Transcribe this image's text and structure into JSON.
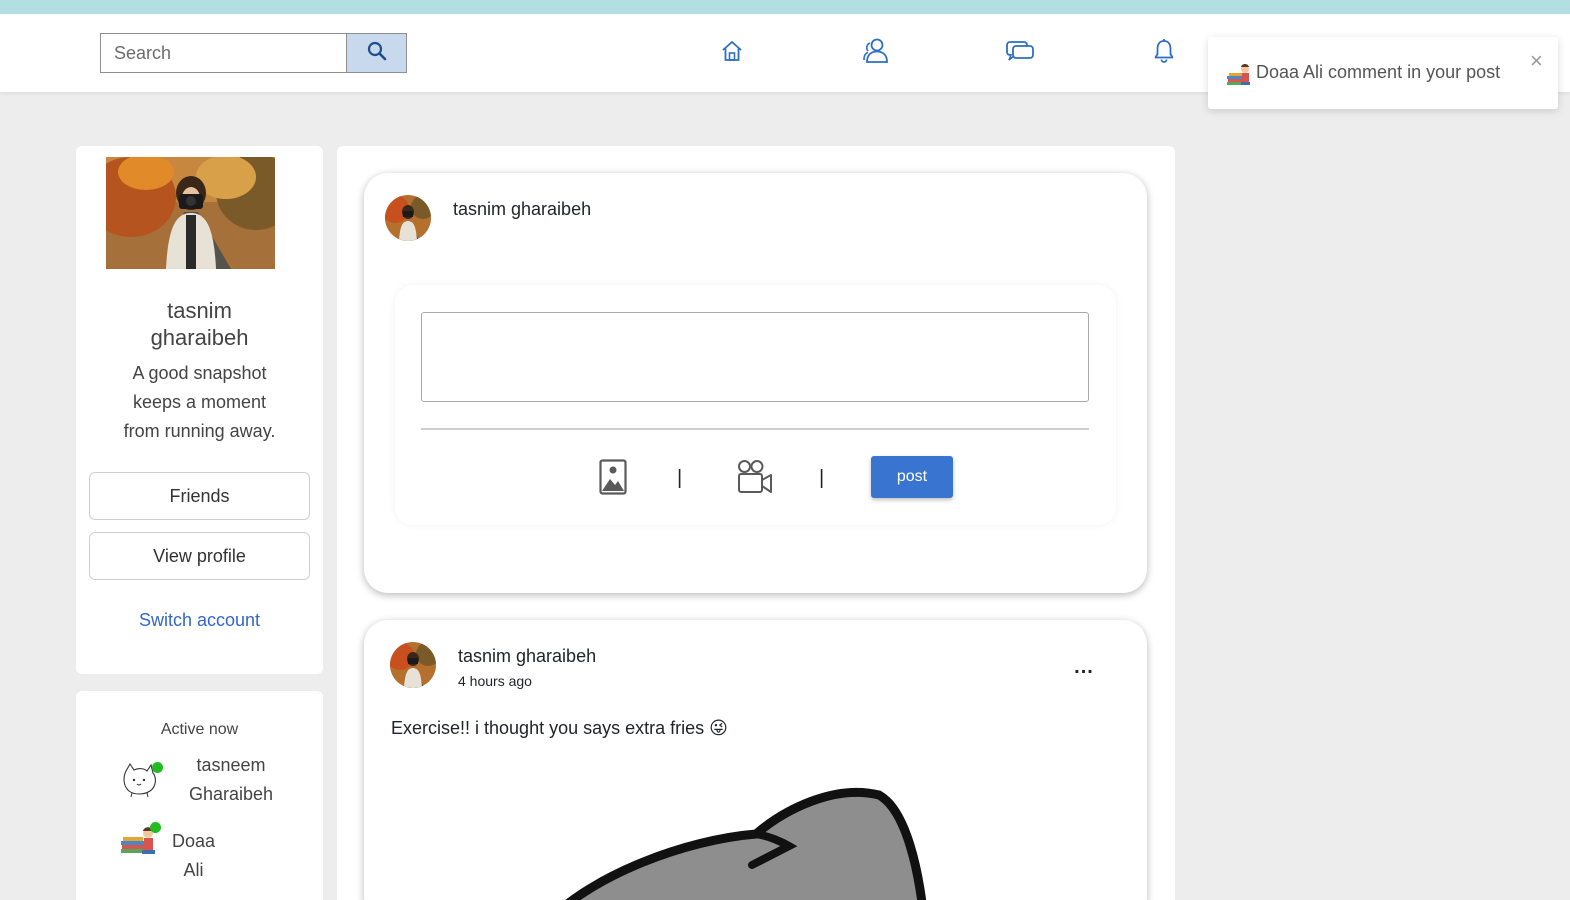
{
  "colors": {
    "top_strip": "#b3dfe2",
    "accent_blue": "#3a74d1",
    "link_blue": "#3366cc",
    "online_green": "#22bb22",
    "page_bg": "#ededed"
  },
  "navbar": {
    "search": {
      "placeholder": "Search",
      "value": "",
      "icon": "search-icon"
    },
    "icons": [
      "home-icon",
      "friends-icon",
      "messages-icon",
      "notifications-icon"
    ]
  },
  "notification_toast": {
    "icon": "books-avatar-icon",
    "text": "Doaa Ali comment in your post",
    "close": "×"
  },
  "profile": {
    "name": "tasnim gharaibeh",
    "bio": "A good snapshot keeps a moment from running away.",
    "friends_button": "Friends",
    "view_profile_button": "View profile",
    "switch_account_link": "Switch account"
  },
  "active_now": {
    "title": "Active now",
    "users": [
      {
        "name": "tasneem Gharaibeh",
        "avatar": "cat-sketch-avatar",
        "online": true
      },
      {
        "name": "Doaa Ali",
        "avatar": "books-avatar",
        "online": true
      }
    ]
  },
  "create_post": {
    "author": "tasnim gharaibeh",
    "text_value": "",
    "image_icon": "image-icon",
    "video_icon": "video-camera-icon",
    "separator": "|",
    "post_button": "post"
  },
  "feed": {
    "posts": [
      {
        "author": "tasnim gharaibeh",
        "time": "4 hours ago",
        "menu": "...",
        "text": "Exercise!! i thought you says extra fries 😜",
        "image": "cat-drawing"
      }
    ]
  }
}
